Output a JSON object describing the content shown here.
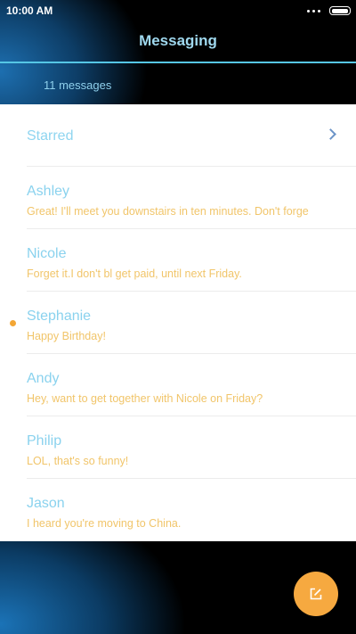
{
  "status_bar": {
    "time": "10:00 AM"
  },
  "header": {
    "title": "Messaging",
    "count_text": "11 messages"
  },
  "list": {
    "starred_label": "Starred",
    "messages": [
      {
        "name": "Ashley",
        "preview": "Great! I'll meet you downstairs in ten minutes. Don't forge",
        "unread": false
      },
      {
        "name": "Nicole",
        "preview": "Forget it.I don't bl get paid, until next Friday.",
        "unread": false
      },
      {
        "name": "Stephanie",
        "preview": "Happy Birthday!",
        "unread": true
      },
      {
        "name": "Andy",
        "preview": "Hey, want to get together with Nicole on Friday?",
        "unread": false
      },
      {
        "name": "Philip",
        "preview": "LOL, that's so funny!",
        "unread": false
      },
      {
        "name": "Jason",
        "preview": "I heard you're moving to China.",
        "unread": false
      }
    ]
  },
  "icons": {
    "status": [
      "more-dots-icon",
      "battery-icon"
    ],
    "starred": "chevron-right-icon",
    "fab": "compose-icon"
  },
  "colors": {
    "accent_line": "#55c6e5",
    "name_text": "#8ad2ee",
    "preview_text": "#f1c56a",
    "unread_dot": "#f3a634",
    "fab": "#f6a940"
  }
}
